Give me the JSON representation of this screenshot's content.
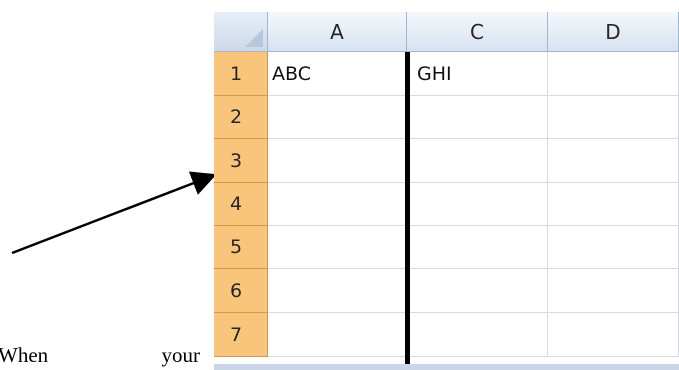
{
  "doc_text": {
    "word1": "When",
    "word2": "your"
  },
  "columns": [
    {
      "letter": "A"
    },
    {
      "letter": "C"
    },
    {
      "letter": "D"
    }
  ],
  "rows": [
    "1",
    "2",
    "3",
    "4",
    "5",
    "6",
    "7"
  ],
  "cells": {
    "A1": "ABC",
    "C1": "GHI"
  }
}
